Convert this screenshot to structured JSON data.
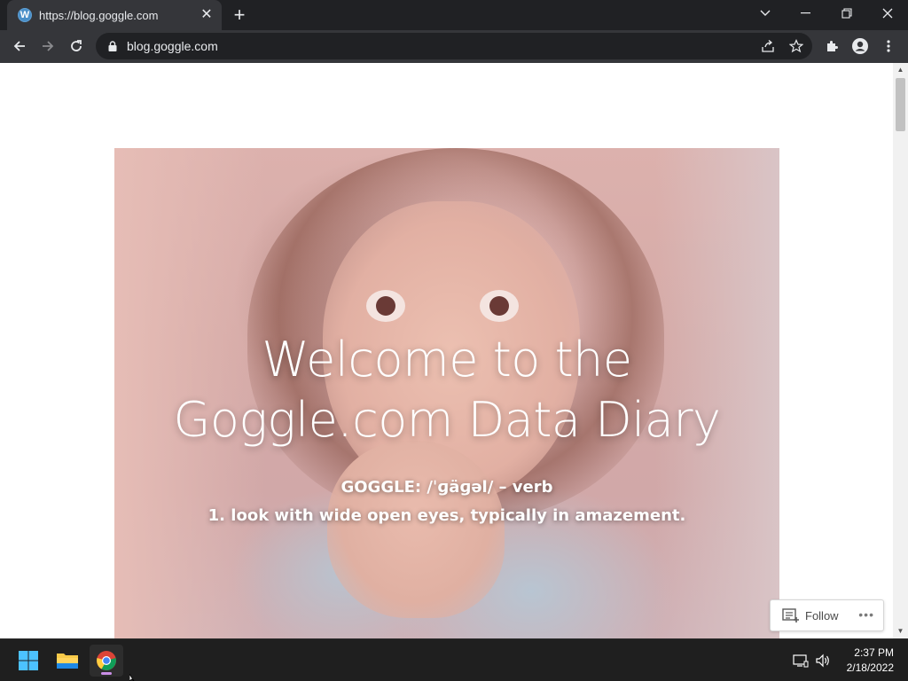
{
  "browser": {
    "tab": {
      "title": "https://blog.goggle.com",
      "favicon": "wordpress-icon"
    },
    "new_tab_label": "+",
    "address": "blog.goggle.com",
    "window_controls": [
      "tab-search",
      "minimize",
      "restore",
      "close"
    ]
  },
  "page": {
    "hero": {
      "title_line1": "Welcome to the",
      "title_line2": "Goggle.com Data Diary",
      "subtitle_line1": "GOGGLE: /ˈɡäɡəl/ – verb",
      "subtitle_line2": "1. look with wide open eyes, typically in amazement."
    },
    "follow": {
      "label": "Follow",
      "more": "•••"
    }
  },
  "taskbar": {
    "apps": [
      "windows-start",
      "file-explorer",
      "chrome"
    ],
    "time": "2:37 PM",
    "date": "2/18/2022"
  },
  "colors": {
    "chrome_dark": "#202124",
    "chrome_toolbar": "#35363a",
    "taskbar": "#1f1f1f",
    "page_bg": "#ffffff"
  }
}
